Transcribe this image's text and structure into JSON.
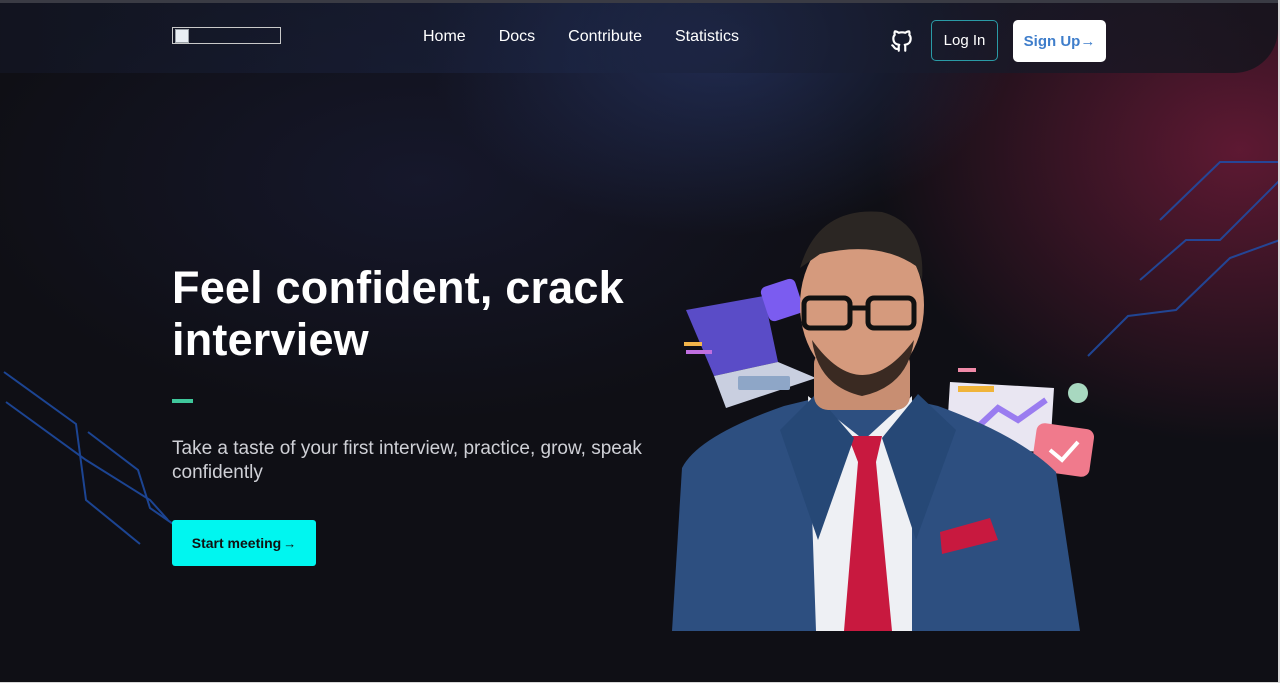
{
  "nav": {
    "links": [
      "Home",
      "Docs",
      "Contribute",
      "Statistics"
    ],
    "login_label": "Log In",
    "signup_label": "Sign Up",
    "signup_arrow": "→"
  },
  "hero": {
    "title": "Feel confident, crack interview",
    "subtitle": "Take a taste of your first interview, practice, grow, speak confidently",
    "cta_label": "Start meeting",
    "cta_arrow": "→"
  },
  "icons": {
    "github": "github-icon",
    "logo": "broken-image-icon"
  },
  "colors": {
    "accent_cyan": "#00f6f0",
    "accent_green": "#3fc79b",
    "signup_text": "#3f7ecb",
    "login_border": "#2a9ba6",
    "background": "#0f0f15"
  }
}
